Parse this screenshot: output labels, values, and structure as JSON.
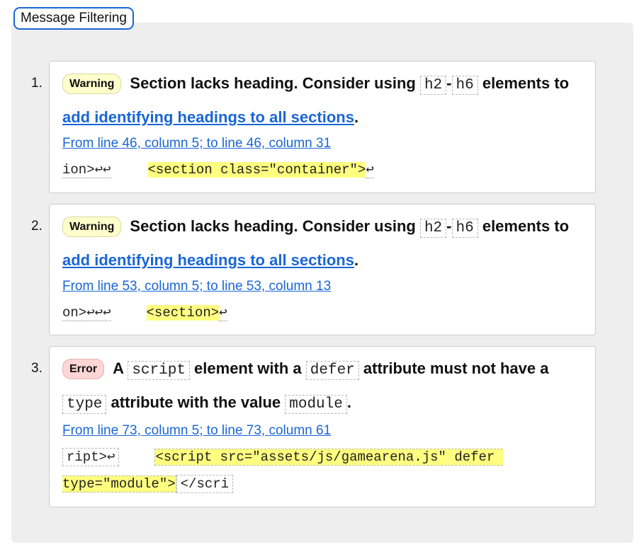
{
  "filter_button": "Message Filtering",
  "messages": [
    {
      "number": "1.",
      "badge": "Warning",
      "text_1": "Section lacks heading. Consider using ",
      "code_1": "h2",
      "sep": "-",
      "code_2": "h6",
      "text_2": " elements to ",
      "link": "add identifying headings to all sections",
      "text_3": ".",
      "location": "From line 46, column 5; to line 46, column 31",
      "extract_before": "ion>↩↩",
      "extract_highlight": "<section class=\"container\">",
      "extract_after": "↩"
    },
    {
      "number": "2.",
      "badge": "Warning",
      "text_1": "Section lacks heading. Consider using ",
      "code_1": "h2",
      "sep": "-",
      "code_2": "h6",
      "text_2": " elements to ",
      "link": "add identifying headings to all sections",
      "text_3": ".",
      "location": "From line 53, column 5; to line 53, column 13",
      "extract_before": "on>↩↩↩",
      "extract_highlight": "<section>",
      "extract_after": "↩"
    },
    {
      "number": "3.",
      "badge": "Error",
      "text_1": "A ",
      "code_1": "script",
      "text_2": " element with a ",
      "code_2": "defer",
      "text_3": " attribute must not have a ",
      "code_3": "type",
      "text_4": " attribute with the value ",
      "code_4": "module",
      "text_5": ".",
      "location": "From line 73, column 5; to line 73, column 61",
      "extract_before": "ript>↩",
      "extract_highlight": "<script src=\"assets/js/gamearena.js\" defer type=\"module\">",
      "extract_after": "</scri"
    }
  ]
}
